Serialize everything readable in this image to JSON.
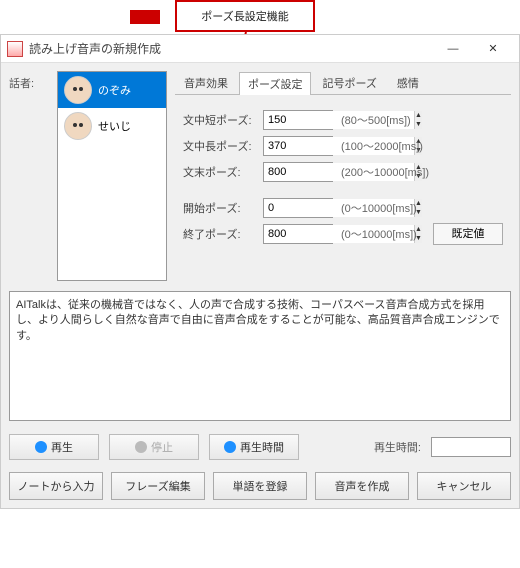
{
  "callout": {
    "label": "ポーズ長設定機能"
  },
  "window": {
    "title": "読み上げ音声の新規作成",
    "minimize": "—",
    "close": "✕"
  },
  "speaker_label": "話者:",
  "speakers": [
    {
      "name": "のぞみ"
    },
    {
      "name": "せいじ"
    }
  ],
  "tabs": {
    "items": [
      "音声効果",
      "ポーズ設定",
      "記号ポーズ",
      "感情"
    ],
    "active_index": 1
  },
  "pause_fields": [
    {
      "label": "文中短ポーズ:",
      "value": "150",
      "range": "(80～500[ms])"
    },
    {
      "label": "文中長ポーズ:",
      "value": "370",
      "range": "(100～2000[ms])"
    },
    {
      "label": "文末ポーズ:",
      "value": "800",
      "range": "(200～10000[ms])"
    }
  ],
  "extra_fields": [
    {
      "label": "開始ポーズ:",
      "value": "0",
      "range": "(0～10000[ms])"
    },
    {
      "label": "終了ポーズ:",
      "value": "800",
      "range": "(0～10000[ms])"
    }
  ],
  "reset_button": "既定値",
  "sample_text": "AITalkは、従来の機械音ではなく、人の声で合成する技術、コーパスベース音声合成方式を採用し、より人間らしく自然な音声で自由に音声合成をすることが可能な、高品質音声合成エンジンです。",
  "play": {
    "play": "再生",
    "stop": "停止",
    "time_btn": "再生時間",
    "time_label": "再生時間:",
    "time_value": ""
  },
  "bottom_buttons": [
    "ノートから入力",
    "フレーズ編集",
    "単語を登録",
    "音声を作成",
    "キャンセル"
  ]
}
